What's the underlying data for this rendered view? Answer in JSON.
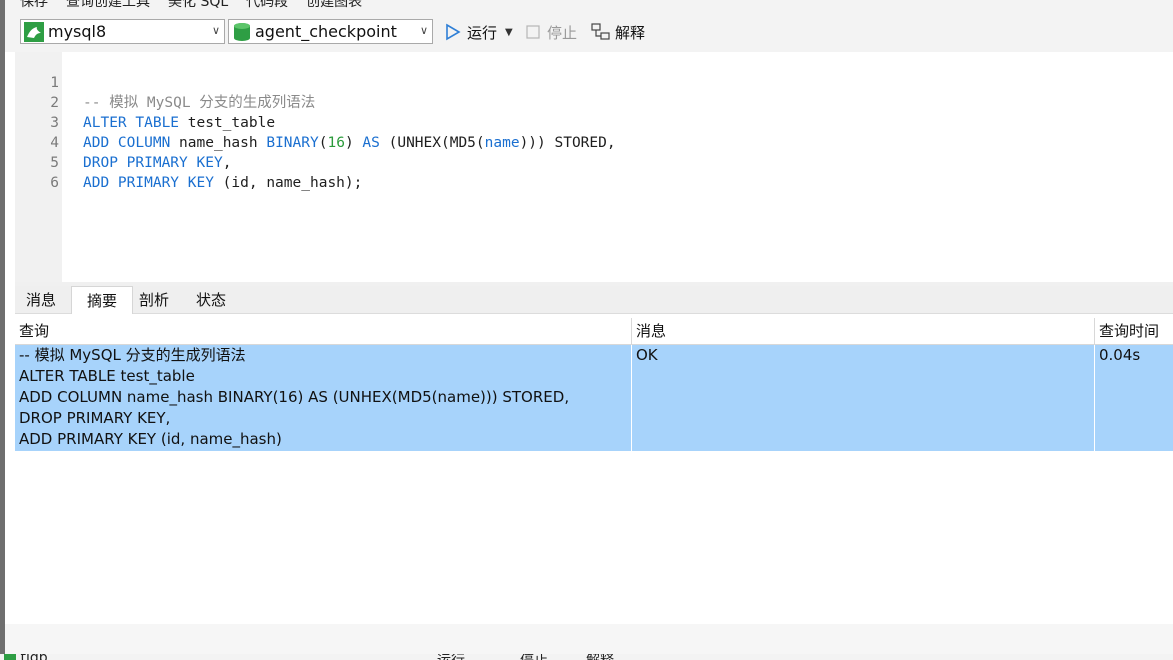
{
  "toolbar": {
    "connection": "mysql8",
    "database": "agent_checkpoint",
    "run_label": "运行",
    "stop_label": "停止",
    "explain_label": "解释"
  },
  "top_cut_toolbar": {
    "items": [
      "保存",
      "查询创建工具",
      "美化 SQL",
      "代码段",
      "创建图表"
    ]
  },
  "editor": {
    "line_numbers": [
      "1",
      "2",
      "3",
      "4",
      "5",
      "6"
    ],
    "lines": [
      [
        {
          "t": "-- 模拟 MySQL 分支的生成列语法",
          "c": "cm"
        }
      ],
      [
        {
          "t": "ALTER TABLE",
          "c": "kw"
        },
        {
          "t": " test_table",
          "c": "plain"
        }
      ],
      [
        {
          "t": "ADD COLUMN",
          "c": "kw"
        },
        {
          "t": " name_hash ",
          "c": "plain"
        },
        {
          "t": "BINARY",
          "c": "kw"
        },
        {
          "t": "(",
          "c": "plain"
        },
        {
          "t": "16",
          "c": "numlit"
        },
        {
          "t": ") ",
          "c": "plain"
        },
        {
          "t": "AS",
          "c": "kw"
        },
        {
          "t": " (UNHEX(MD5(",
          "c": "plain"
        },
        {
          "t": "name",
          "c": "kw"
        },
        {
          "t": "))) STORED,",
          "c": "plain"
        }
      ],
      [
        {
          "t": "DROP PRIMARY KEY",
          "c": "kw"
        },
        {
          "t": ",",
          "c": "plain"
        }
      ],
      [
        {
          "t": "ADD PRIMARY KEY",
          "c": "kw"
        },
        {
          "t": " (id, name_hash);",
          "c": "plain"
        }
      ],
      []
    ]
  },
  "result_tabs": [
    "消息",
    "摘要",
    "剖析",
    "状态"
  ],
  "result_grid": {
    "headers": [
      "查询",
      "消息",
      "查询时间"
    ],
    "rows": [
      {
        "query_lines": [
          "-- 模拟 MySQL 分支的生成列语法",
          "ALTER TABLE test_table",
          "ADD COLUMN name_hash BINARY(16) AS (UNHEX(MD5(name))) STORED,",
          "DROP PRIMARY KEY,",
          "ADD PRIMARY KEY (id, name_hash)"
        ],
        "message": "OK",
        "time": "0.04s"
      }
    ]
  },
  "bottom_cut_toolbar": {
    "connection": "tidb",
    "run_label": "运行",
    "stop_label": "停止",
    "explain_label": "解释"
  },
  "colors": {
    "keyword": "#1a6fd0",
    "comment": "#8a8a8a",
    "number": "#2a9a3a",
    "selected_row": "#a7d3fb"
  }
}
